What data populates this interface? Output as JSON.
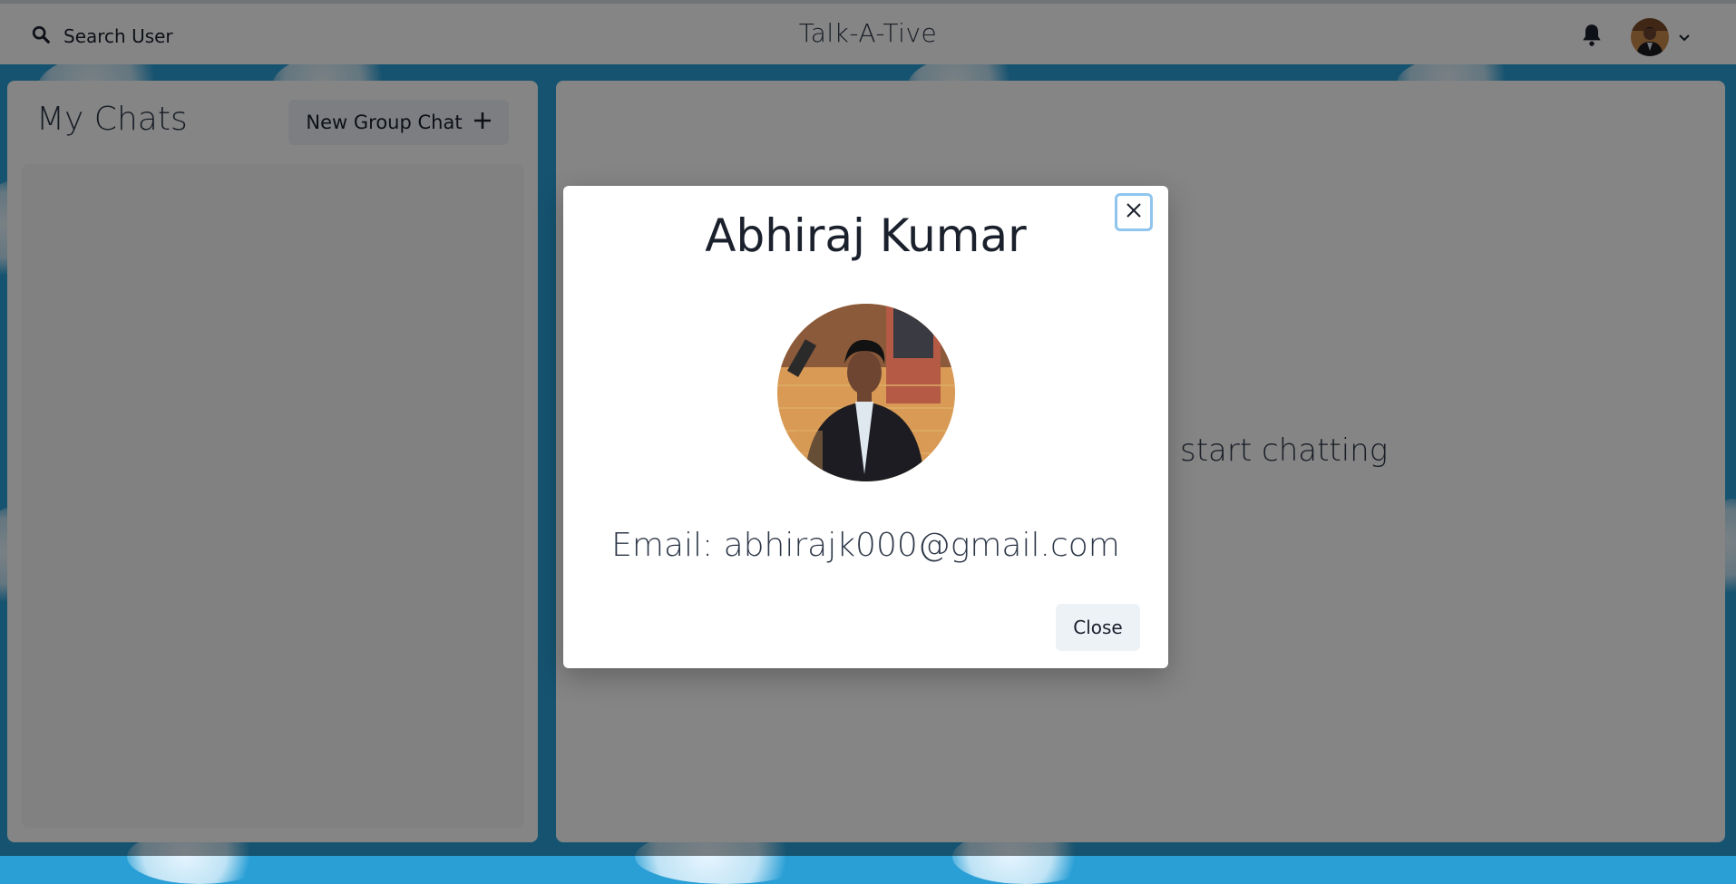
{
  "header": {
    "search_label": "Search User",
    "app_title": "Talk-A-Tive"
  },
  "sidebar": {
    "title": "My Chats",
    "new_group_label": "New Group Chat"
  },
  "main": {
    "hint_text": "start chatting"
  },
  "profile_modal": {
    "name": "Abhiraj Kumar",
    "email": "Email: abhirajk000@gmail.com",
    "close_label": "Close"
  },
  "colors": {
    "background": "#2a9fd6",
    "overlay": "rgba(0,0,0,0.48)",
    "focus_ring": "#90c5ee",
    "button_bg": "#edf2f7"
  }
}
